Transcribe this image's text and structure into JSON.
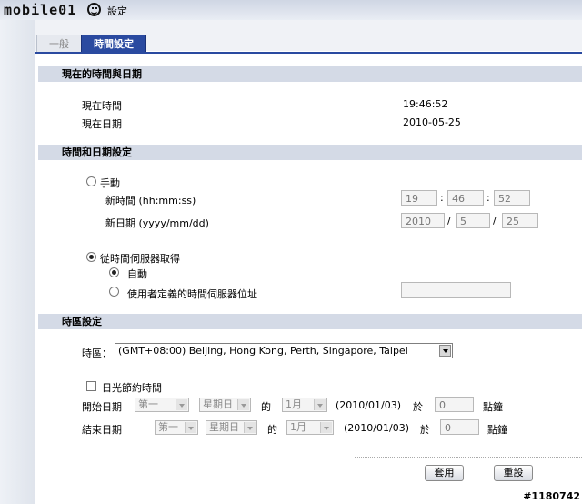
{
  "header": {
    "logo": "mobile01",
    "title": "設定",
    "logo_icon": "smiley-icon"
  },
  "tabs": [
    {
      "label": "一般"
    },
    {
      "label": "時間設定"
    }
  ],
  "current": {
    "section_title": "現在的時間與日期",
    "time_label": "現在時間",
    "time_value": "19:46:52",
    "date_label": "現在日期",
    "date_value": "2010-05-25"
  },
  "setting": {
    "section_title": "時間和日期設定",
    "manual_label": "手動",
    "new_time_label": "新時間 (hh:mm:ss)",
    "new_time": {
      "h": "19",
      "m": "46",
      "s": "52"
    },
    "new_date_label": "新日期 (yyyy/mm/dd)",
    "new_date": {
      "y": "2010",
      "m": "5",
      "d": "25"
    },
    "time_sep": ":",
    "date_sep": "/",
    "server_label": "從時間伺服器取得",
    "auto_label": "自動",
    "custom_label": "使用者定義的時間伺服器位址",
    "custom_value": ""
  },
  "timezone": {
    "section_title": "時區設定",
    "tz_label": "時區：",
    "tz_value": "(GMT+08:00) Beijing, Hong Kong, Perth, Singapore, Taipei",
    "dst_label": "日光節約時間",
    "start": {
      "label": "開始日期",
      "week": "第一",
      "weekday": "星期日",
      "of": "的",
      "month": "1月",
      "date_text": "(2010/01/03)",
      "at": "於",
      "hour": "0",
      "unit": "點鐘"
    },
    "end": {
      "label": "結束日期",
      "week": "第一",
      "weekday": "星期日",
      "of": "的",
      "month": "1月",
      "date_text": "(2010/01/03)",
      "at": "於",
      "hour": "0",
      "unit": "點鐘"
    }
  },
  "buttons": {
    "apply": "套用",
    "reset": "重設"
  },
  "watermark": "#1180742"
}
